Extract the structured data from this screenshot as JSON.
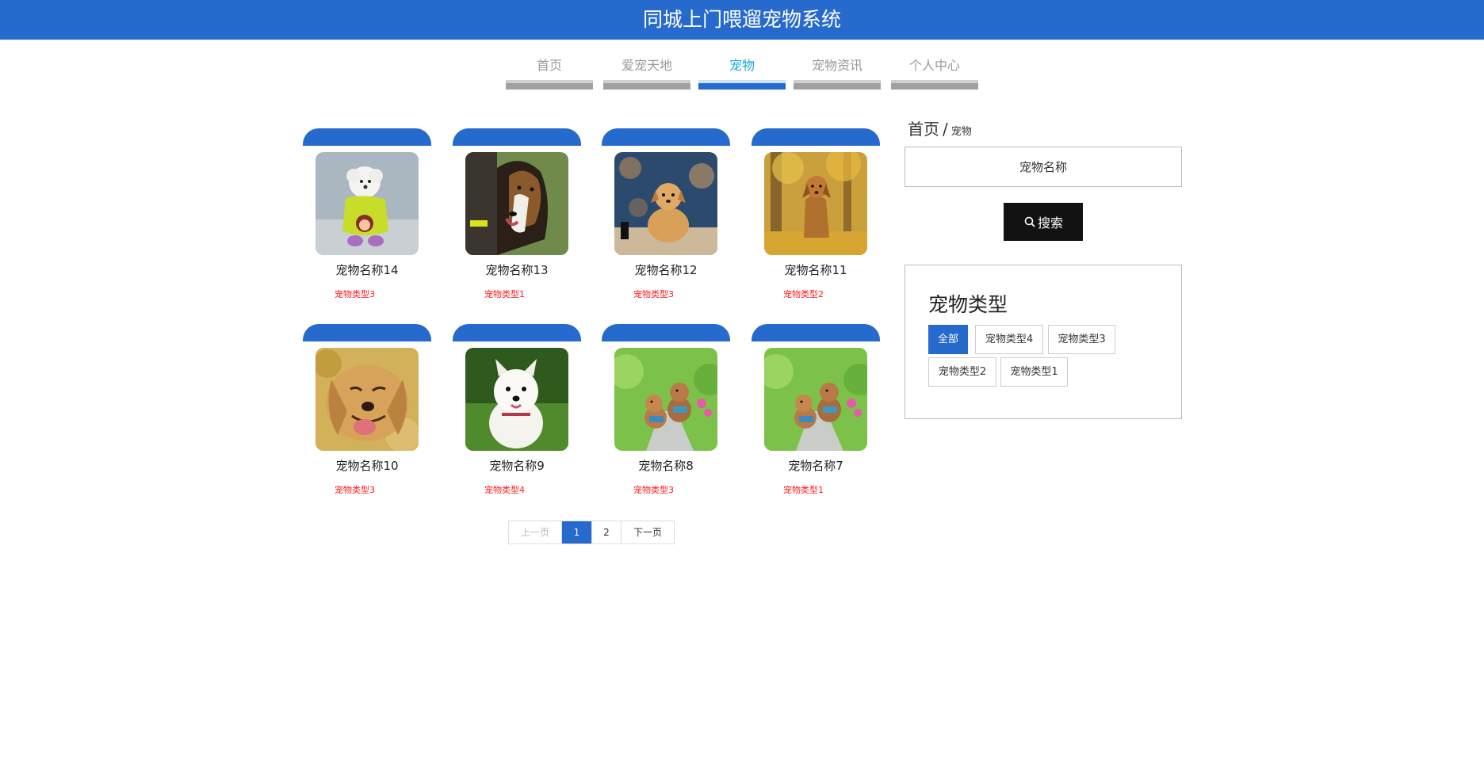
{
  "header": {
    "title": "同城上门喂遛宠物系统"
  },
  "nav": {
    "items": [
      {
        "label": "首页"
      },
      {
        "label": "爱宠天地"
      },
      {
        "label": "宠物"
      },
      {
        "label": "宠物资讯"
      },
      {
        "label": "个人中心"
      }
    ],
    "active_index": 2
  },
  "pets": [
    {
      "name": "宠物名称14",
      "type": "宠物类型3",
      "image": "white-poodle-in-yellow-sweater"
    },
    {
      "name": "宠物名称13",
      "type": "宠物类型1",
      "image": "collie-dog"
    },
    {
      "name": "宠物名称12",
      "type": "宠物类型3",
      "image": "dog-sitting-on-pillow"
    },
    {
      "name": "宠物名称11",
      "type": "宠物类型2",
      "image": "golden-dog-in-autumn-leaves"
    },
    {
      "name": "宠物名称10",
      "type": "宠物类型3",
      "image": "golden-retriever-smiling"
    },
    {
      "name": "宠物名称9",
      "type": "宠物类型4",
      "image": "west-highland-terrier-on-grass"
    },
    {
      "name": "宠物名称8",
      "type": "宠物类型3",
      "image": "two-poodles-running-on-path"
    },
    {
      "name": "宠物名称7",
      "type": "宠物类型1",
      "image": "two-poodles-running-on-path"
    }
  ],
  "pagination": {
    "prev_label": "上一页",
    "pages": [
      "1",
      "2"
    ],
    "current_page": "1",
    "next_label": "下一页"
  },
  "sidebar": {
    "breadcrumb": {
      "home": "首页",
      "separator": "/",
      "current": "宠物"
    },
    "search": {
      "placeholder": "宠物名称",
      "button_label": "搜索",
      "button_icon": "search-icon"
    },
    "types": {
      "title": "宠物类型",
      "tags": [
        "全部",
        "宠物类型4",
        "宠物类型3",
        "宠物类型2",
        "宠物类型1"
      ],
      "active_index": 0
    }
  },
  "colors": {
    "primary": "#266ace",
    "nav_active": "#1ba7de",
    "type_text": "#ff1a1a",
    "search_button": "#121212"
  }
}
